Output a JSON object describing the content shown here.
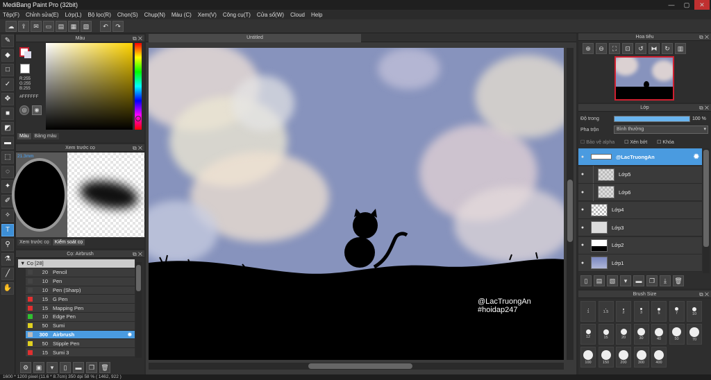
{
  "app": {
    "title": "MediBang Paint Pro (32bit)"
  },
  "window_controls": {
    "minimize": "—",
    "maximize": "▢",
    "close": "✕"
  },
  "menu": [
    "Tệp(F)",
    "Chỉnh sửa(E)",
    "Lớp(L)",
    "Bộ lọc(R)",
    "Chọn(S)",
    "Chụp(N)",
    "Màu (C)",
    "Xem(V)",
    "Công cụ(T)",
    "Cửa sổ(W)",
    "Cloud",
    "Help"
  ],
  "color_panel": {
    "title": "Màu",
    "rgb_r": "R:255",
    "rgb_g": "G:255",
    "rgb_b": "B:255",
    "hex": "#FFFFFF",
    "tabs": [
      "Màu",
      "Bảng màu"
    ]
  },
  "preview_panel": {
    "title": "Xem trước cọ",
    "size_label": "21.3mm",
    "tabs": [
      "Xem trước cọ",
      "Kiểm soát cọ"
    ]
  },
  "brush_panel": {
    "title": "Cọ: Airbrush",
    "group": "Cọ [28]",
    "brushes": [
      {
        "size": "20",
        "name": "Pencil",
        "color": "#444444"
      },
      {
        "size": "10",
        "name": "Pen",
        "color": "#444444"
      },
      {
        "size": "10",
        "name": "Pen (Sharp)",
        "color": "#444444"
      },
      {
        "size": "15",
        "name": "G Pen",
        "color": "#e03030"
      },
      {
        "size": "15",
        "name": "Mapping Pen",
        "color": "#e03030"
      },
      {
        "size": "10",
        "name": "Edge Pen",
        "color": "#30c030"
      },
      {
        "size": "50",
        "name": "Sumi",
        "color": "#e0d020"
      },
      {
        "size": "300",
        "name": "Airbrush",
        "color": "#bbbbbb",
        "selected": true
      },
      {
        "size": "50",
        "name": "Stipple Pen",
        "color": "#e0d020"
      },
      {
        "size": "15",
        "name": "Sumi 3",
        "color": "#e03030"
      }
    ]
  },
  "canvas": {
    "tab": "Untitled",
    "watermark_line1": "@LacTruongAn",
    "watermark_line2": "#hoidap247"
  },
  "navigator": {
    "title": "Hoa tiêu"
  },
  "layer_panel": {
    "title": "Lớp",
    "opacity_label": "Độ trong",
    "opacity_value": "100 %",
    "opacity_fraction": 1.0,
    "blend_label": "Pha trộn",
    "blend_value": "Bình thường",
    "protect_alpha": "Bảo vệ alpha",
    "clipping": "Xén bớt",
    "lock": "Khóa",
    "layers": [
      {
        "name": "@LacTruongAn",
        "selected": true,
        "folder": true
      },
      {
        "name": "Lớp5",
        "indent": true
      },
      {
        "name": "Lớp6",
        "indent": true
      },
      {
        "name": "Lớp4"
      },
      {
        "name": "Lớp3"
      },
      {
        "name": "Lớp2"
      },
      {
        "name": "Lớp1"
      }
    ]
  },
  "brush_size_panel": {
    "title": "Brush Size",
    "sizes": [
      "1",
      "1.5",
      "2",
      "3",
      "5",
      "7",
      "10",
      "12",
      "15",
      "20",
      "30",
      "40",
      "50",
      "70",
      "100",
      "150",
      "200",
      "300",
      "400"
    ]
  },
  "status": {
    "text": "1600 * 1200 pixel   (11.6 * 8.7cm)   350 dpi   58 %   ( 1462, 922 )"
  }
}
